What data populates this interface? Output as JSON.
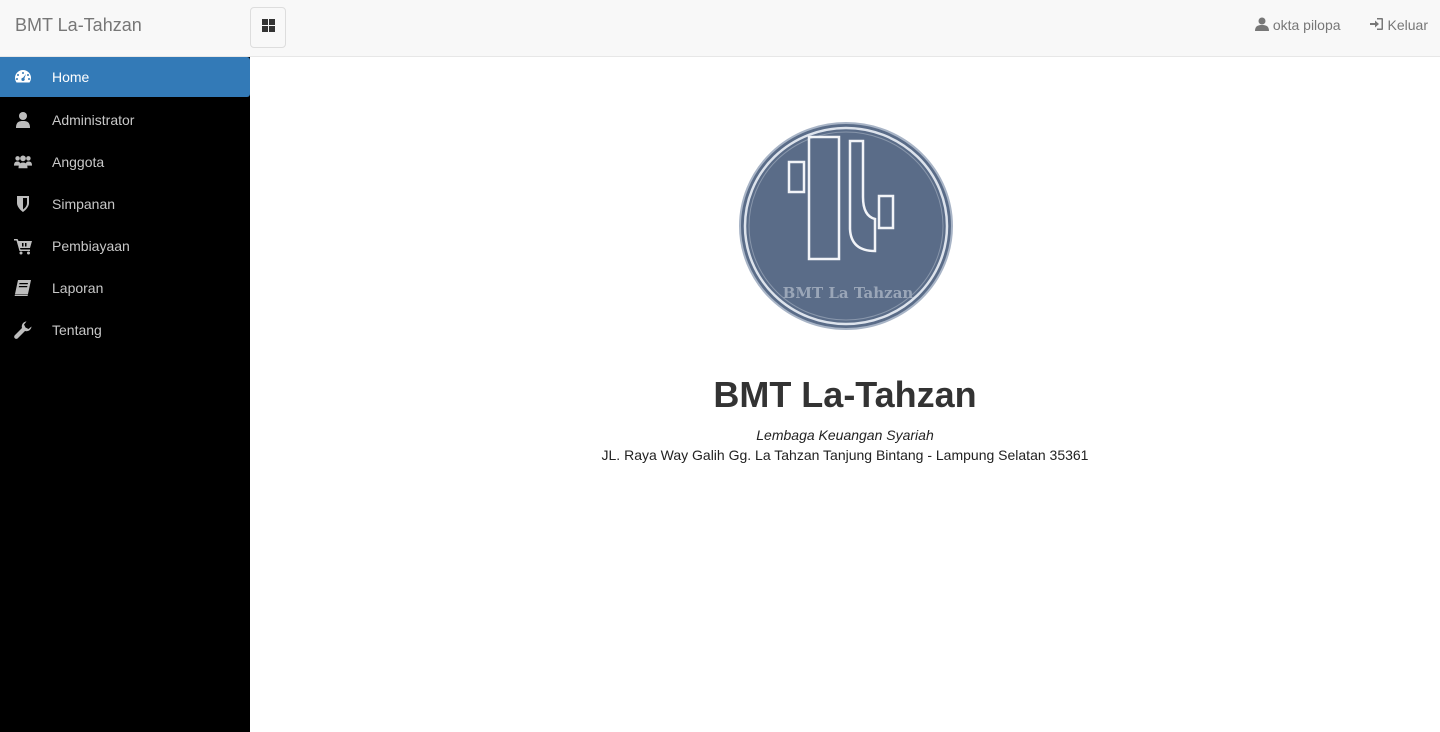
{
  "navbar": {
    "brand": "BMT La-Tahzan",
    "toggle_icon": "grid-icon",
    "user_name": "okta pilopa",
    "logout_label": "Keluar"
  },
  "sidebar": {
    "items": [
      {
        "label": "Home",
        "icon": "dashboard-icon",
        "active": true
      },
      {
        "label": "Administrator",
        "icon": "user-icon"
      },
      {
        "label": "Anggota",
        "icon": "users-icon"
      },
      {
        "label": "Simpanan",
        "icon": "shield-icon"
      },
      {
        "label": "Pembiayaan",
        "icon": "cart-icon"
      },
      {
        "label": "Laporan",
        "icon": "book-icon"
      },
      {
        "label": "Tentang",
        "icon": "wrench-icon"
      }
    ]
  },
  "main": {
    "logo_text": "BMT La Tahzan",
    "title": "BMT La-Tahzan",
    "subtitle": "Lembaga Keuangan Syariah",
    "address": "JL. Raya Way Galih Gg. La Tahzan Tanjung Bintang - Lampung Selatan 35361"
  },
  "colors": {
    "navbar_bg": "#f8f8f8",
    "sidebar_bg": "#000000",
    "active_item": "#337ab7",
    "logo_fill": "#5a6c88"
  }
}
